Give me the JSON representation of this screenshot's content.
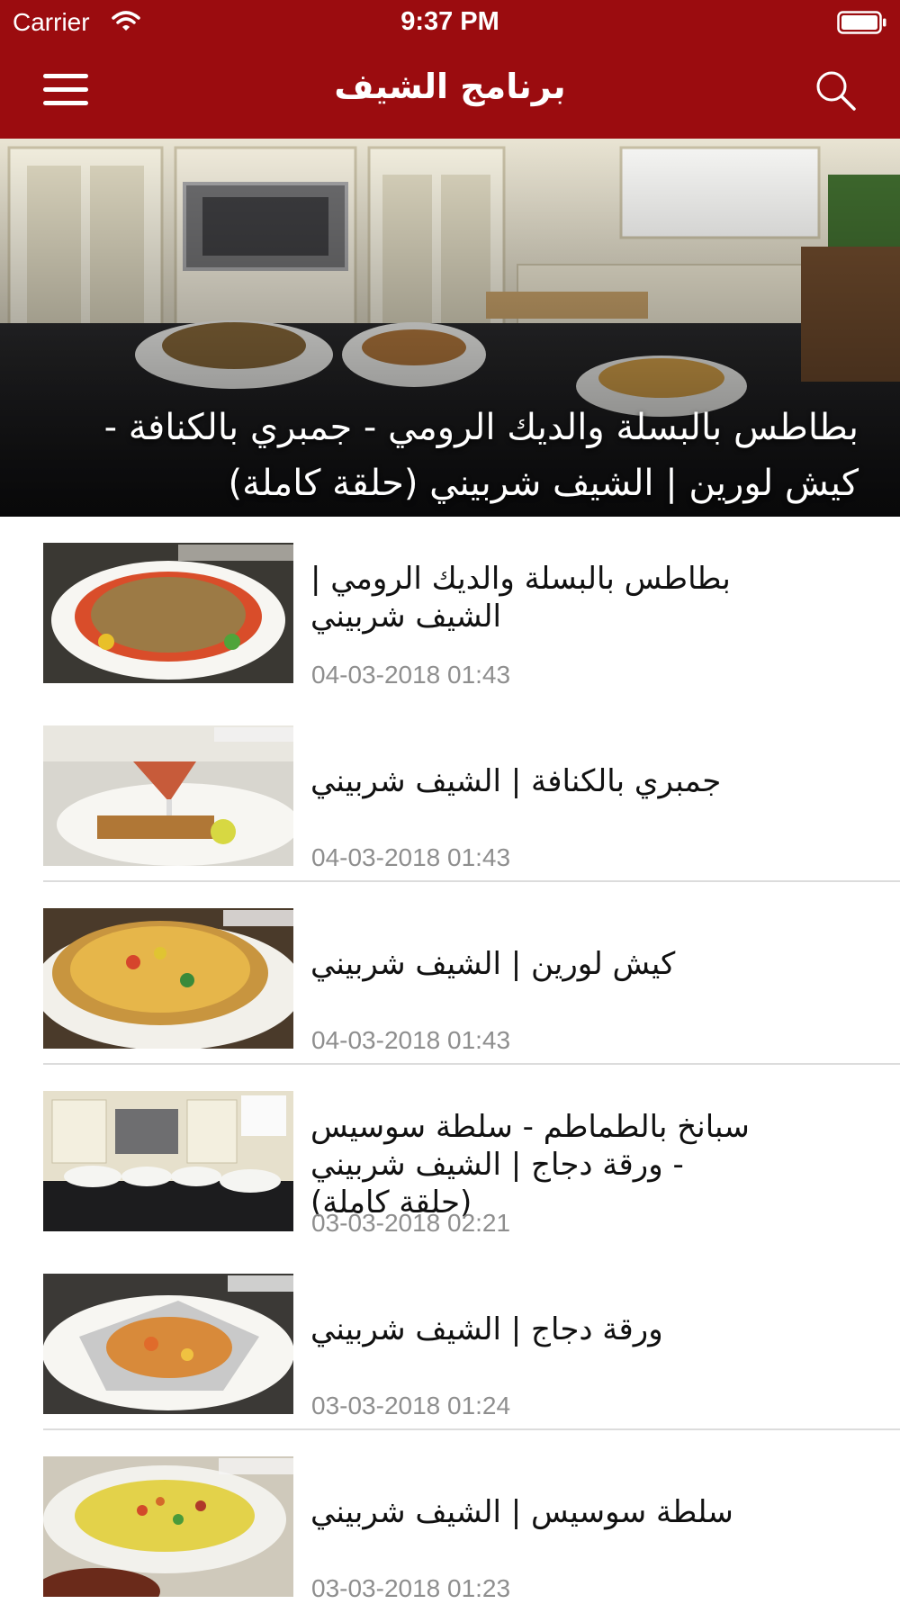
{
  "status_bar": {
    "carrier": "Carrier",
    "time": "9:37 PM"
  },
  "header": {
    "title": "برنامج الشيف",
    "menu_icon": "hamburger-menu-icon",
    "search_icon": "search-icon"
  },
  "hero": {
    "title": "بطاطس بالبسلة والديك الرومي - جمبري بالكنافة - كيش لورين | الشيف شربيني (حلقة كاملة)"
  },
  "videos": [
    {
      "title": "بطاطس بالبسلة والديك الرومي  | الشيف شربيني",
      "date": "04-03-2018 01:43",
      "thumb_caption": "بطاطس بالبسلة والديك الرومي"
    },
    {
      "title": "جمبري بالكنافة  | الشيف شربيني",
      "date": "04-03-2018 01:43",
      "thumb_caption": "جمبري بالكنافة"
    },
    {
      "title": "كيش لورين  | الشيف شربيني",
      "date": "04-03-2018 01:43",
      "thumb_caption": "كيش لورين"
    },
    {
      "title": "سبانخ بالطماطم - سلطة سوسيس - ورقة دجاج | الشيف شربيني (حلقة كاملة)",
      "date": "03-03-2018 02:21",
      "thumb_caption": ""
    },
    {
      "title": "ورقة دجاج  | الشيف شربيني",
      "date": "03-03-2018 01:24",
      "thumb_caption": "ورقة دجاج"
    },
    {
      "title": "سلطة سوسيس | الشيف شربيني",
      "date": "03-03-2018 01:23",
      "thumb_caption": "سلطة سوسيس"
    }
  ],
  "colors": {
    "brand_red": "#9b0c0f",
    "date_gray": "#8e8e8e",
    "divider": "#dcdcdc"
  }
}
